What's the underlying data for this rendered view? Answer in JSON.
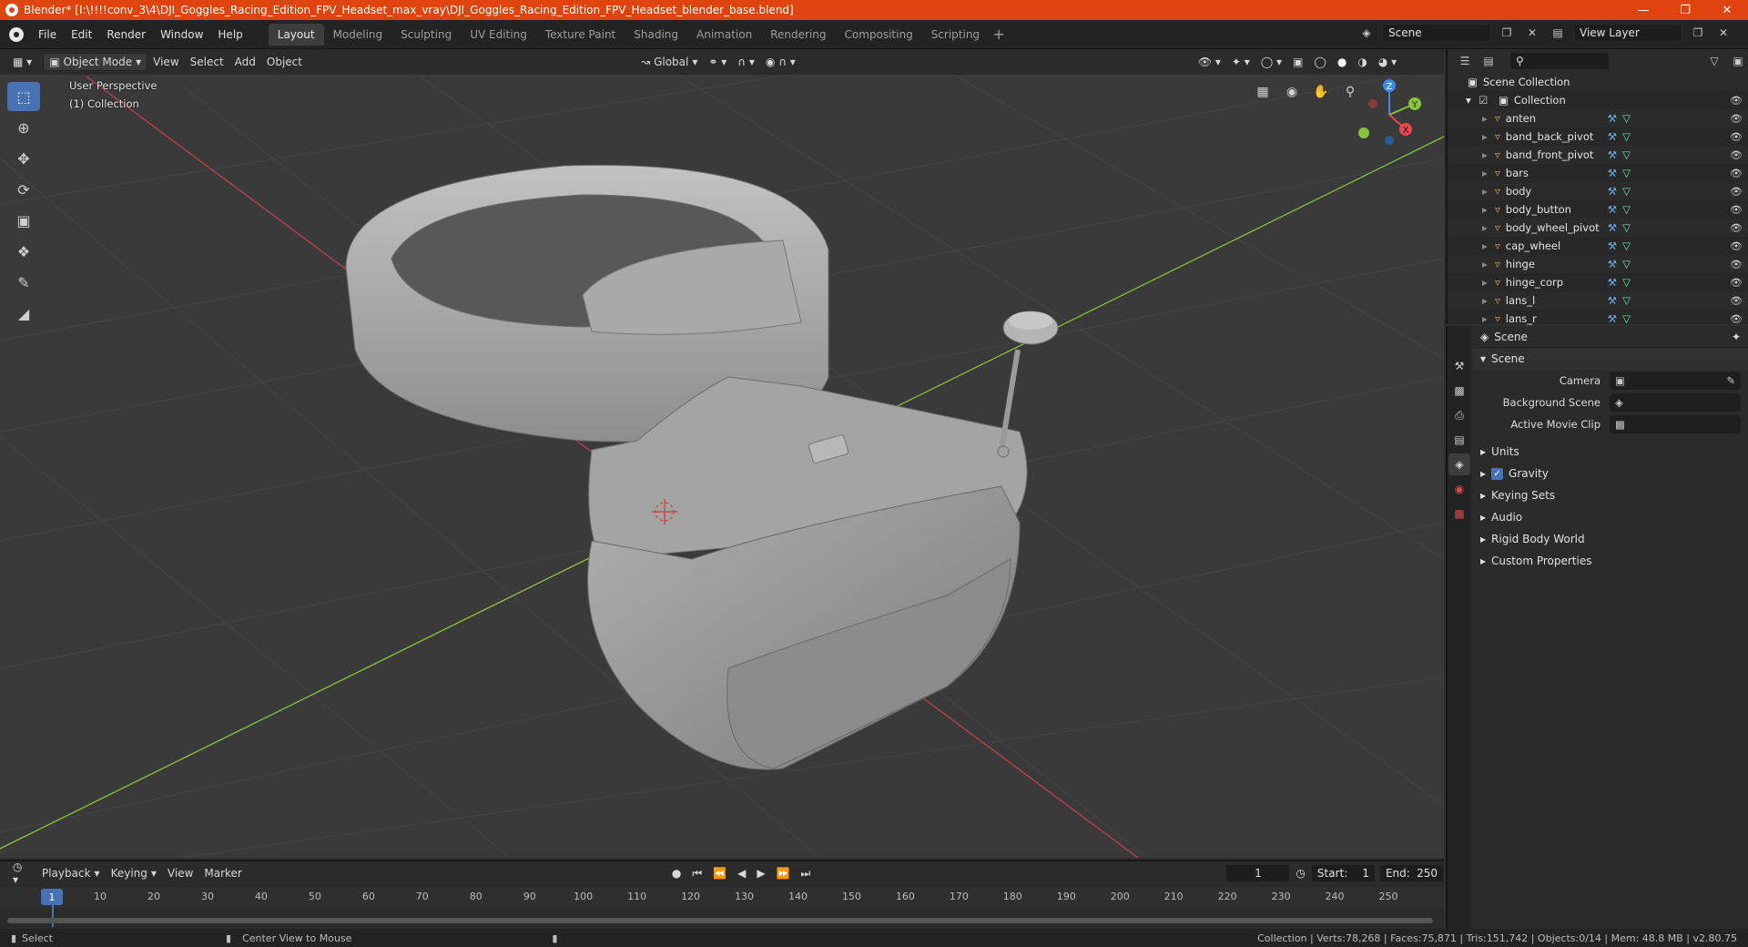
{
  "titlebar": {
    "title": "Blender* [I:\\!!!!conv_3\\4\\DJI_Goggles_Racing_Edition_FPV_Headset_max_vray\\DJI_Goggles_Racing_Edition_FPV_Headset_blender_base.blend]",
    "minimize_icon": "minimize-icon",
    "maximize_icon": "restore-icon",
    "close_icon": "close-icon"
  },
  "menu": [
    "File",
    "Edit",
    "Render",
    "Window",
    "Help"
  ],
  "workspaces": [
    "Layout",
    "Modeling",
    "Sculpting",
    "UV Editing",
    "Texture Paint",
    "Shading",
    "Animation",
    "Rendering",
    "Compositing",
    "Scripting"
  ],
  "active_workspace": "Layout",
  "scene_selector": {
    "scene": "Scene",
    "view_layer": "View Layer"
  },
  "viewport_header": {
    "mode": "Object Mode",
    "menus": [
      "View",
      "Select",
      "Add",
      "Object"
    ],
    "transform_orientation": "Global"
  },
  "viewport": {
    "perspective_label": "User Perspective",
    "collection_label": "(1) Collection",
    "gizmo_axes": [
      "X",
      "Y",
      "Z"
    ]
  },
  "outliner": {
    "root": "Scene Collection",
    "collection": "Collection",
    "objects": [
      "anten",
      "band_back_pivot",
      "band_front_pivot",
      "bars",
      "body",
      "body_button",
      "body_wheel_pivot",
      "cap_wheel",
      "hinge",
      "hinge_corp",
      "lans_l",
      "lans_r"
    ]
  },
  "properties": {
    "context": "Scene",
    "panel_title": "Scene",
    "fields": [
      {
        "label": "Camera",
        "value": ""
      },
      {
        "label": "Background Scene",
        "value": ""
      },
      {
        "label": "Active Movie Clip",
        "value": ""
      }
    ],
    "subpanels": [
      "Units",
      "Gravity",
      "Keying Sets",
      "Audio",
      "Rigid Body World",
      "Custom Properties"
    ],
    "gravity_checked": true
  },
  "timeline": {
    "menus": [
      "Playback",
      "Keying",
      "View",
      "Marker"
    ],
    "current_frame": "1",
    "start_label": "Start:",
    "start": "1",
    "end_label": "End:",
    "end": "250",
    "ticks": [
      "1",
      "10",
      "20",
      "30",
      "40",
      "50",
      "60",
      "70",
      "80",
      "90",
      "100",
      "110",
      "120",
      "130",
      "140",
      "150",
      "160",
      "170",
      "180",
      "190",
      "200",
      "210",
      "220",
      "230",
      "240",
      "250"
    ]
  },
  "statusbar": {
    "left_action": "Select",
    "middle_action": "Center View to Mouse",
    "stats": "Collection | Verts:78,268 | Faces:75,871 | Tris:151,742 | Objects:0/14 | Mem: 48.8 MB | v2.80.75"
  },
  "colors": {
    "title_bar": "#e0440e",
    "accent": "#4772b3",
    "x_axis": "#e8484f",
    "y_axis": "#85c43c",
    "z_axis": "#3b8ae8"
  }
}
